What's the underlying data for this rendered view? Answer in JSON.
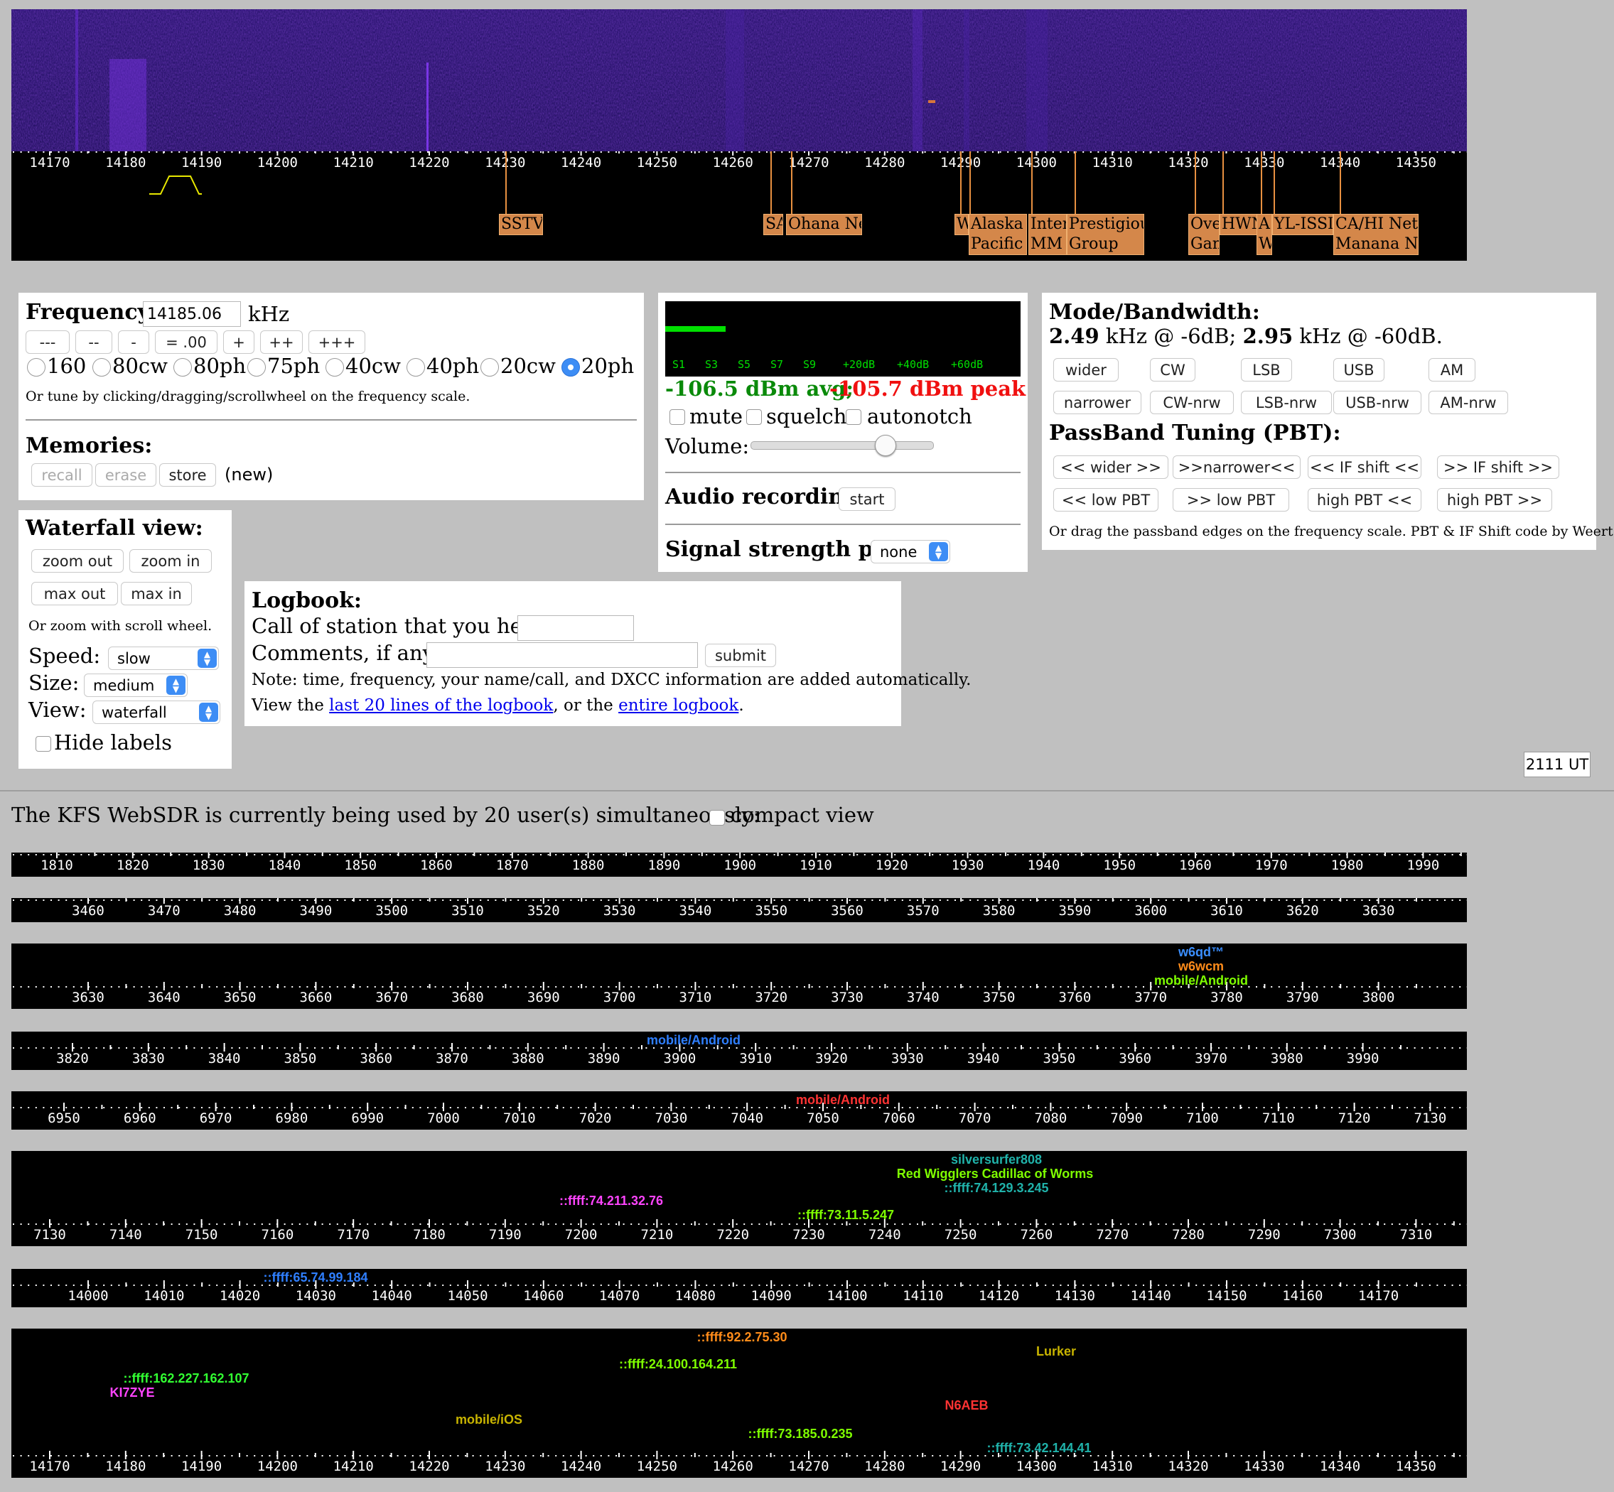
{
  "main_scale": {
    "ticks": [
      "14170",
      "14180",
      "14190",
      "14200",
      "14210",
      "14220",
      "14230",
      "14240",
      "14250",
      "14260",
      "14270",
      "14280",
      "14290",
      "14300",
      "14310",
      "14320",
      "14330",
      "14340",
      "14350"
    ],
    "labels": [
      {
        "text": "SSTV"
      },
      {
        "text": "SA"
      },
      {
        "text": "Ohana Net"
      },
      {
        "text": "W"
      },
      {
        "text": "Alaska\nPacific N"
      },
      {
        "text": "Interc\nMM"
      },
      {
        "text": "Prestigious\nGroup"
      },
      {
        "text": "Ove\nGan"
      },
      {
        "text": "HWN"
      },
      {
        "text": "A\nW"
      },
      {
        "text": "YL-ISSI"
      },
      {
        "text": "CA/HI Net\nManana Net"
      }
    ]
  },
  "frequency": {
    "label": "Frequency:",
    "value": "14185.06",
    "unit": "kHz",
    "steps": [
      "---",
      "--",
      "-",
      "= .00",
      "+",
      "++",
      "+++"
    ],
    "bands": [
      "160",
      "80cw",
      "80ph",
      "75ph",
      "40cw",
      "40ph",
      "20cw",
      "20ph"
    ],
    "selected_band": "20ph",
    "hint": "Or tune by clicking/dragging/scrollwheel on the frequency scale."
  },
  "memories": {
    "title": "Memories:",
    "recall": "recall",
    "erase": "erase",
    "store": "store",
    "status": "(new)"
  },
  "smeter": {
    "scale": [
      "S1",
      "S3",
      "S5",
      "S7",
      "S9",
      "+20dB",
      "+40dB",
      "+60dB"
    ],
    "avg": "-106.5 dBm avg;",
    "peak": "-105.7 dBm peak",
    "level": 0.17
  },
  "audio": {
    "mute": "mute",
    "squelch": "squelch",
    "autonotch": "autonotch",
    "volume_label": "Volume:",
    "volume": 0.74,
    "recording_label": "Audio recording:",
    "recording_button": "start",
    "plot_label": "Signal strength plot:",
    "plot_value": "none"
  },
  "mode": {
    "title": "Mode/Bandwidth:",
    "bw1": "2.49",
    "bw1_text": " kHz @ -6dB; ",
    "bw2": "2.95",
    "bw2_text": " kHz @ -60dB.",
    "row1": [
      "wider",
      "CW",
      "LSB",
      "USB",
      "AM"
    ],
    "row2": [
      "narrower",
      "CW-nrw",
      "LSB-nrw",
      "USB-nrw",
      "AM-nrw"
    ],
    "pbt_title": "PassBand Tuning (PBT):",
    "pbt_row1": [
      "<< wider >>",
      ">>narrower<<",
      "<< IF shift <<",
      ">> IF shift >>"
    ],
    "pbt_row2": [
      "<< low PBT",
      ">> low PBT",
      "high PBT <<",
      "high PBT >>"
    ],
    "pbt_note": "Or drag the passband edges on the frequency scale. PBT & IF Shift code by Weert Websdr."
  },
  "waterfall": {
    "title": "Waterfall view:",
    "zoom_out": "zoom out",
    "zoom_in": "zoom in",
    "max_out": "max out",
    "max_in": "max in",
    "hint": "Or zoom with scroll wheel.",
    "speed_label": "Speed:",
    "speed": "slow",
    "size_label": "Size:",
    "size": "medium",
    "view_label": "View:",
    "view": "waterfall",
    "hide_labels": "Hide labels"
  },
  "logbook": {
    "title": "Logbook:",
    "call_label": "Call of station that you hear:",
    "comments_label": "Comments, if any:",
    "submit": "submit",
    "note": "Note: time, frequency, your name/call, and DXCC information are added automatically.",
    "view_pre": "View the ",
    "link1": "last 20 lines of the logbook",
    "view_mid": ", or the ",
    "link2": "entire logbook",
    "view_post": "."
  },
  "clock": "2111 UT",
  "users": {
    "text": "The KFS WebSDR is currently being used by 20 user(s) simultaneously:",
    "compact": "compact view"
  },
  "bands": [
    {
      "ticks": [
        "1810",
        "1820",
        "1830",
        "1840",
        "1850",
        "1860",
        "1870",
        "1880",
        "1890",
        "1900",
        "1910",
        "1920",
        "1930",
        "1940",
        "1950",
        "1960",
        "1970",
        "1980",
        "1990"
      ],
      "users": []
    },
    {
      "ticks": [
        "3460",
        "3470",
        "3480",
        "3490",
        "3500",
        "3510",
        "3520",
        "3530",
        "3540",
        "3550",
        "3560",
        "3570",
        "3580",
        "3590",
        "3600",
        "3610",
        "3620",
        "3630"
      ],
      "users": []
    },
    {
      "ticks": [
        "3630",
        "3640",
        "3650",
        "3660",
        "3670",
        "3680",
        "3690",
        "3700",
        "3710",
        "3720",
        "3730",
        "3740",
        "3750",
        "3760",
        "3770",
        "3780",
        "3790",
        "3800"
      ],
      "users": [
        {
          "name": "w6qd™",
          "color": "#3a8eff"
        },
        {
          "name": "w6wcm",
          "color": "#ff8c1a"
        },
        {
          "name": "mobile/Android",
          "color": "#7fff00"
        }
      ]
    },
    {
      "ticks": [
        "3820",
        "3830",
        "3840",
        "3850",
        "3860",
        "3870",
        "3880",
        "3890",
        "3900",
        "3910",
        "3920",
        "3930",
        "3940",
        "3950",
        "3960",
        "3970",
        "3980",
        "3990"
      ],
      "users": [
        {
          "name": "mobile/Android",
          "color": "#2f7fff"
        }
      ]
    },
    {
      "ticks": [
        "6950",
        "6960",
        "6970",
        "6980",
        "6990",
        "7000",
        "7010",
        "7020",
        "7030",
        "7040",
        "7050",
        "7060",
        "7070",
        "7080",
        "7090",
        "7100",
        "7110",
        "7120",
        "7130"
      ],
      "users": [
        {
          "name": "mobile/Android",
          "color": "#ff3333"
        }
      ]
    },
    {
      "ticks": [
        "7130",
        "7140",
        "7150",
        "7160",
        "7170",
        "7180",
        "7190",
        "7200",
        "7210",
        "7220",
        "7230",
        "7240",
        "7250",
        "7260",
        "7270",
        "7280",
        "7290",
        "7300",
        "7310"
      ],
      "users": [
        {
          "name": "silversurfer808",
          "color": "#20b2aa"
        },
        {
          "name": "Red Wigglers Cadillac of Worms",
          "color": "#7fff00"
        },
        {
          "name": "::ffff:74.129.3.245",
          "color": "#20b2aa"
        },
        {
          "name": "::ffff:74.211.32.76",
          "color": "#ff44ff"
        },
        {
          "name": "::ffff:73.11.5.247",
          "color": "#7fff00"
        }
      ]
    },
    {
      "ticks": [
        "14000",
        "14010",
        "14020",
        "14030",
        "14040",
        "14050",
        "14060",
        "14070",
        "14080",
        "14090",
        "14100",
        "14110",
        "14120",
        "14130",
        "14140",
        "14150",
        "14160",
        "14170"
      ],
      "users": [
        {
          "name": "::ffff:65.74.99.184",
          "color": "#2f7fff"
        }
      ]
    },
    {
      "ticks": [
        "14170",
        "14180",
        "14190",
        "14200",
        "14210",
        "14220",
        "14230",
        "14240",
        "14250",
        "14260",
        "14270",
        "14280",
        "14290",
        "14300",
        "14310",
        "14320",
        "14330",
        "14340",
        "14350"
      ],
      "users": [
        {
          "name": "::ffff:92.2.75.30",
          "color": "#ff8c1a"
        },
        {
          "name": "Lurker",
          "color": "#c8b400"
        },
        {
          "name": "::ffff:24.100.164.211",
          "color": "#7fff00"
        },
        {
          "name": "::ffff:162.227.162.107",
          "color": "#32ff32"
        },
        {
          "name": "KI7ZYE",
          "color": "#ff44ff"
        },
        {
          "name": "N6AEB",
          "color": "#ff3333"
        },
        {
          "name": "mobile/iOS",
          "color": "#c8b400"
        },
        {
          "name": "::ffff:73.185.0.235",
          "color": "#7fff00"
        },
        {
          "name": "::ffff:73.42.144.41",
          "color": "#20b2aa"
        }
      ]
    }
  ]
}
